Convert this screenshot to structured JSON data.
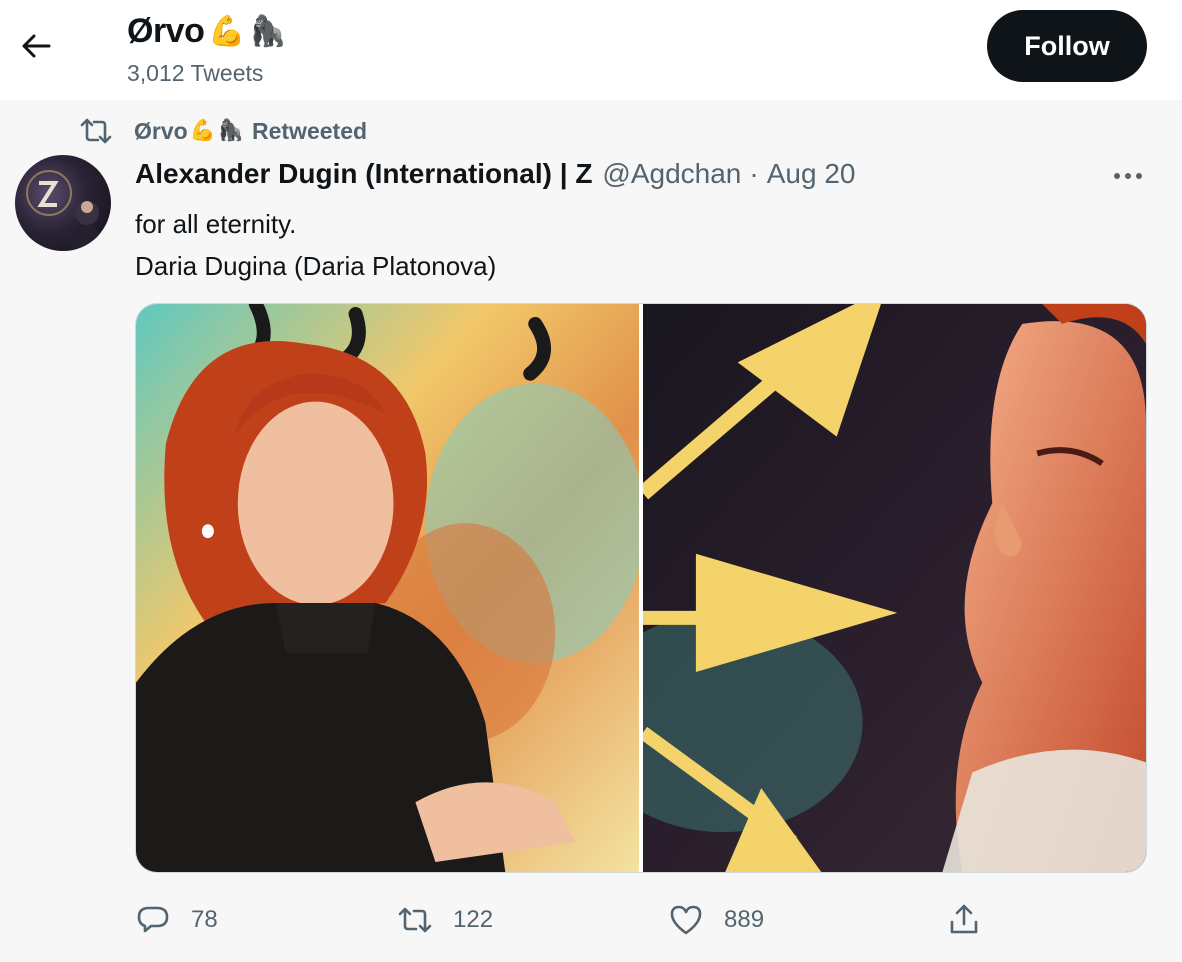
{
  "header": {
    "name": "Ørvo",
    "name_emojis": [
      "💪",
      "🦍"
    ],
    "tweet_count": "3,012 Tweets",
    "follow_label": "Follow"
  },
  "retweet": {
    "name": "Ørvo",
    "name_emojis": [
      "💪",
      "🦍"
    ],
    "suffix": "Retweeted"
  },
  "tweet": {
    "author_name": "Alexander Dugin (International) | Z",
    "handle": "@Agdchan",
    "separator": "·",
    "date": "Aug 20",
    "text_lines": [
      "for all eternity.",
      "Daria Dugina (Daria Platonova)"
    ],
    "actions": {
      "replies": "78",
      "retweets": "122",
      "likes": "889"
    }
  },
  "colors": {
    "text_primary": "#0f1419",
    "text_secondary": "#536471",
    "follow_bg": "#0f1419",
    "page_bg": "#f7f7f7"
  },
  "icons": {
    "back": "arrow-left-icon",
    "retweet": "retweet-icon",
    "more": "more-horizontal-icon",
    "reply": "reply-icon",
    "like": "heart-icon",
    "share": "share-icon"
  }
}
